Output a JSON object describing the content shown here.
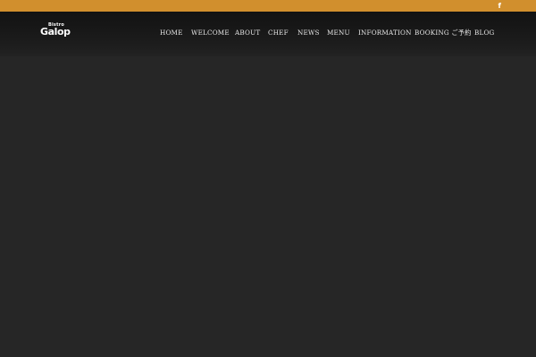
{
  "topbar": {
    "facebook_glyph": "f",
    "color": "#d18f2d"
  },
  "header": {
    "logo": {
      "small": "Bistro",
      "main": "Galop"
    },
    "nav": {
      "home": "HOME",
      "welcome": "WELCOME",
      "about": "ABOUT",
      "chef": "CHEF",
      "news": "NEWS",
      "menu": "MENU",
      "information": "INFORMATION",
      "booking": "BOOKING ご予約",
      "blog": "BLOG"
    }
  },
  "colors": {
    "background": "#262626",
    "accent": "#d18f2d",
    "nav_text": "#e8e8e8"
  }
}
